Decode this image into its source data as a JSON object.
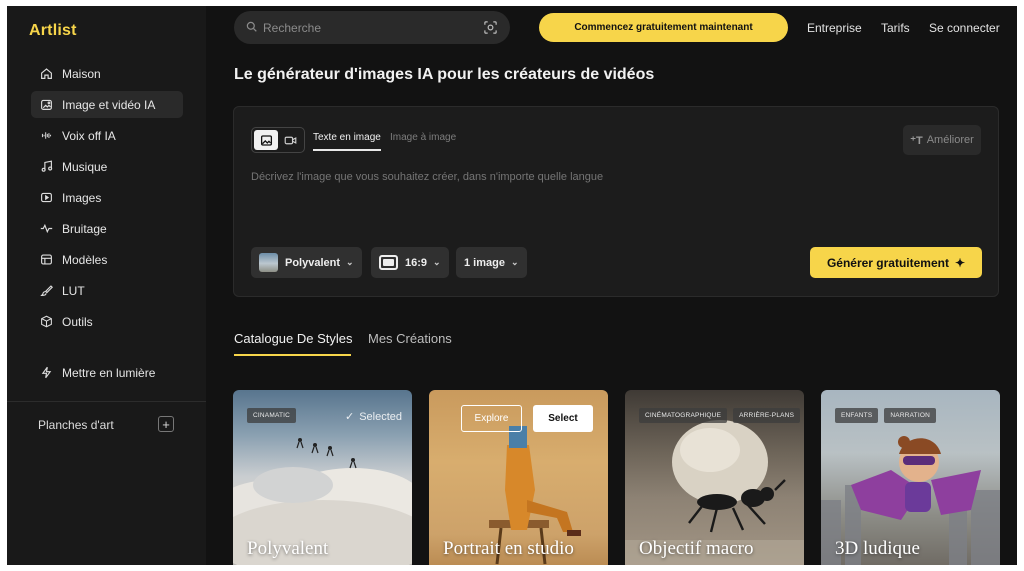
{
  "app": {
    "logo": "Artlist"
  },
  "sidebar": {
    "items": [
      {
        "label": "Maison",
        "icon": "home-icon"
      },
      {
        "label": "Image et vidéo IA",
        "icon": "image-ai-icon",
        "active": true
      },
      {
        "label": "Voix off IA",
        "icon": "waveform-icon"
      },
      {
        "label": "Musique",
        "icon": "music-note-icon"
      },
      {
        "label": "Images",
        "icon": "play-box-icon"
      },
      {
        "label": "Bruitage",
        "icon": "pulse-icon"
      },
      {
        "label": "Modèles",
        "icon": "template-icon"
      },
      {
        "label": "LUT",
        "icon": "brush-icon"
      },
      {
        "label": "Outils",
        "icon": "cube-icon"
      },
      {
        "label": "Mettre en lumière",
        "icon": "lightning-icon"
      }
    ],
    "boards_label": "Planches d'art",
    "boards_add": "+"
  },
  "topbar": {
    "search_placeholder": "Recherche",
    "cta": "Commencez gratuitement maintenant",
    "links": [
      "Entreprise",
      "Tarifs",
      "Se connecter"
    ]
  },
  "main": {
    "title": "Le générateur d'images IA pour les créateurs de vidéos",
    "prompt": {
      "tabs": [
        "Texte en image",
        "Image à image"
      ],
      "enhance": "Améliorer",
      "enhance_glyph": "⁺T",
      "placeholder": "Décrivez l'image que vous souhaitez créer, dans n'importe quelle langue",
      "style_chip": "Polyvalent",
      "ratio_chip": "16:9",
      "count_chip": "1 image",
      "generate": "Générer gratuitement",
      "generate_glyph": "✦"
    },
    "section_tabs": [
      "Catalogue De Styles",
      "Mes Créations"
    ],
    "cards": [
      {
        "title": "Polyvalent",
        "tags": [
          "CINAMATIC"
        ],
        "selected_label": "Selected"
      },
      {
        "title": "Portrait en studio",
        "explore": "Explore",
        "select": "Select"
      },
      {
        "title": "Objectif macro",
        "tags": [
          "CINÉMATOGRAPHIQUE",
          "ARRIÈRE-PLANS"
        ]
      },
      {
        "title": "3D ludique",
        "tags": [
          "ENFANTS",
          "NARRATION"
        ]
      }
    ]
  },
  "colors": {
    "accent": "#f7d54a",
    "background": "#121212",
    "sidebar": "#191919"
  }
}
